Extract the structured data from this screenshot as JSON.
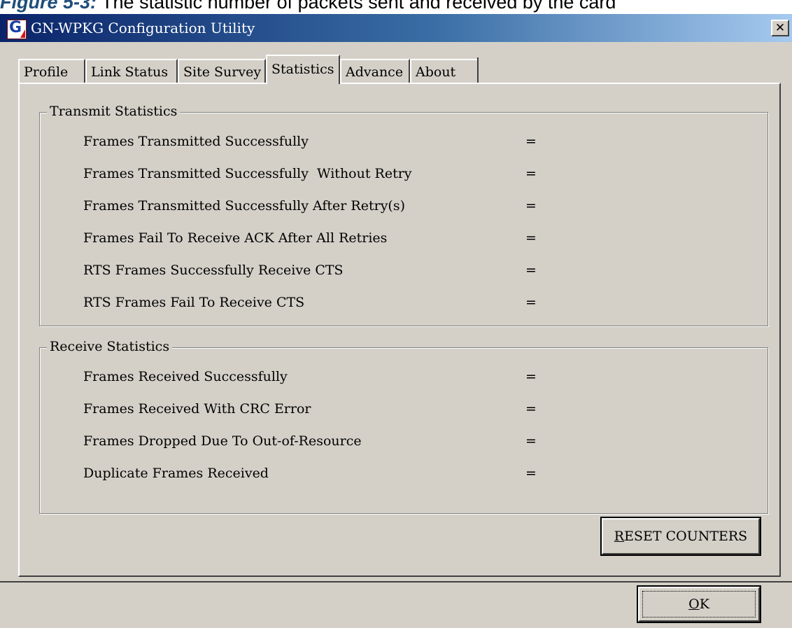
{
  "caption": {
    "figure": "Figure 5-3:",
    "text": "The statistic number of packets sent and received by the card"
  },
  "window": {
    "title": "GN-WPKG Configuration Utility",
    "close_glyph": "✕",
    "icon_letter": "G"
  },
  "tabs": [
    {
      "label": "Profile",
      "active": false
    },
    {
      "label": "Link Status",
      "active": false
    },
    {
      "label": "Site Survey",
      "active": false
    },
    {
      "label": "Statistics",
      "active": true
    },
    {
      "label": "Advance",
      "active": false
    },
    {
      "label": "About",
      "active": false
    }
  ],
  "transmit": {
    "title": "Transmit Statistics",
    "rows": [
      {
        "label": "Frames Transmitted Successfully",
        "eq": "=",
        "value": ""
      },
      {
        "label": "Frames Transmitted Successfully  Without Retry",
        "eq": "=",
        "value": ""
      },
      {
        "label": "Frames Transmitted Successfully After Retry(s)",
        "eq": "=",
        "value": ""
      },
      {
        "label": "Frames Fail To Receive ACK After All Retries",
        "eq": "=",
        "value": ""
      },
      {
        "label": "RTS Frames Successfully Receive CTS",
        "eq": "=",
        "value": ""
      },
      {
        "label": "RTS Frames Fail To Receive CTS",
        "eq": "=",
        "value": ""
      }
    ]
  },
  "receive": {
    "title": "Receive Statistics",
    "rows": [
      {
        "label": "Frames Received Successfully",
        "eq": "=",
        "value": ""
      },
      {
        "label": "Frames Received With CRC Error",
        "eq": "=",
        "value": ""
      },
      {
        "label": "Frames Dropped Due To Out-of-Resource",
        "eq": "=",
        "value": ""
      },
      {
        "label": "Duplicate Frames Received",
        "eq": "=",
        "value": ""
      }
    ]
  },
  "buttons": {
    "reset_mnemonic": "R",
    "reset_rest": "ESET COUNTERS",
    "ok_mnemonic": "O",
    "ok_rest": "K"
  }
}
